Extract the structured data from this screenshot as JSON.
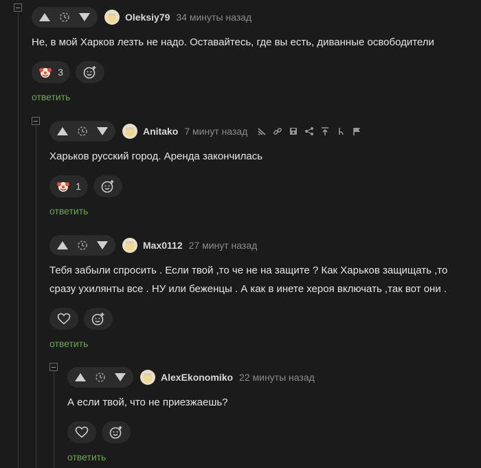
{
  "comments": [
    {
      "user": "Oleksiy79",
      "time": "34 минуты назад",
      "text": "Не, в мой Харков лезть не надо. Оставайтесь, где вы есть, диванные освободители",
      "reaction_count": "3",
      "reply_label": "ответить"
    },
    {
      "user": "Anitako",
      "time": "7 минут назад",
      "text": "Харьков русский город. Аренда закончилась",
      "reaction_count": "1",
      "reply_label": "ответить"
    },
    {
      "user": "Max0112",
      "time": "27 минут назад",
      "text": "Тебя забыли спросить . Если твой ,то че не на защите ? Как Харьков защищать ,то сразу ухилянты все . НУ или беженцы . А как в инете хероя включать ,так вот они .",
      "reply_label": "ответить"
    },
    {
      "user": "AlexEkonomiko",
      "time": "22 минуты назад",
      "text": "А если твой, что не приезжаешь?",
      "reply_label": "ответить"
    }
  ],
  "icons": {
    "upvote": "triangle-up-icon",
    "history": "clock-history-icon",
    "downvote": "triangle-down-icon",
    "clown": "clown-emoji-icon",
    "add_reaction": "add-emoji-icon",
    "like": "heart-icon",
    "thread_tools": [
      "branch-icon",
      "link-icon",
      "save-icon",
      "share-icon",
      "go-to-parent-icon",
      "author-icon",
      "report-flag-icon"
    ]
  },
  "colors": {
    "background": "#1b1b1b",
    "reply_link": "#6aa84f",
    "pill": "#2a2a2a"
  }
}
